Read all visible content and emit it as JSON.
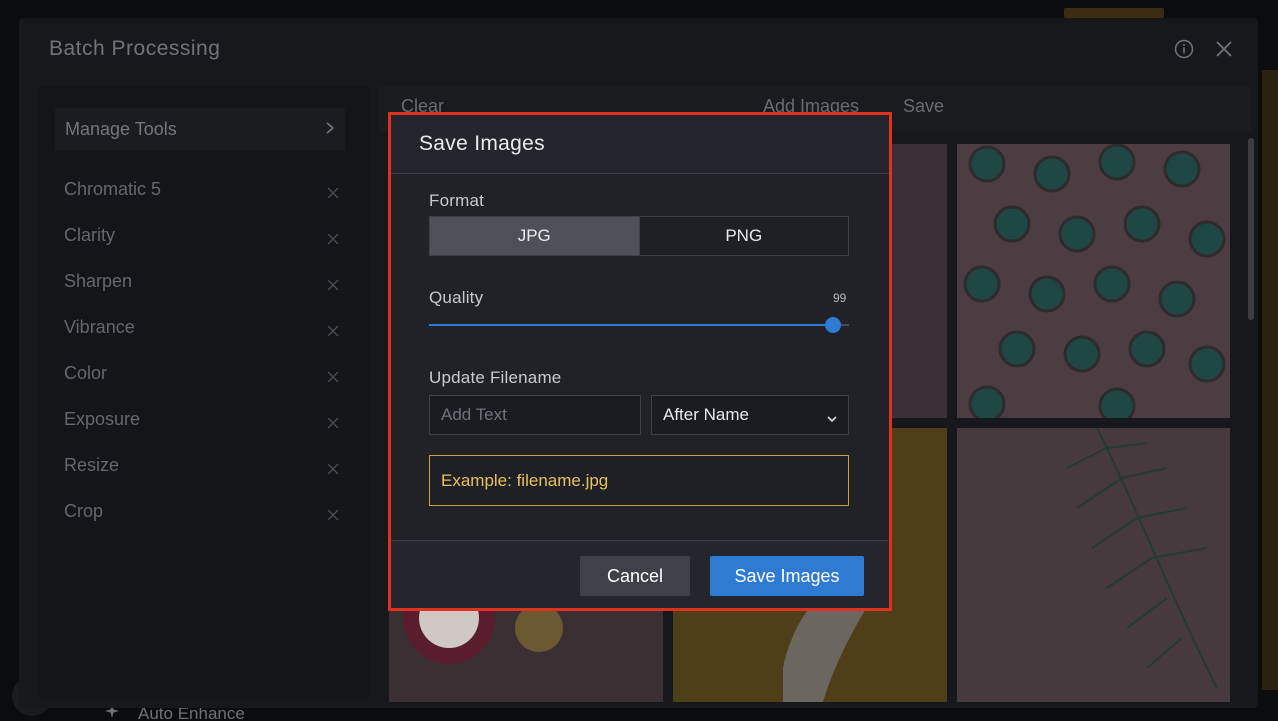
{
  "batch": {
    "title": "Batch Processing",
    "toolbar": {
      "clear_label": "Clear",
      "add_images_label": "Add Images",
      "save_label": "Save"
    },
    "sidebar": {
      "manage_tools_label": "Manage Tools",
      "tools": [
        {
          "label": "Chromatic 5"
        },
        {
          "label": "Clarity"
        },
        {
          "label": "Sharpen"
        },
        {
          "label": "Vibrance"
        },
        {
          "label": "Color"
        },
        {
          "label": "Exposure"
        },
        {
          "label": "Resize"
        },
        {
          "label": "Crop"
        }
      ]
    },
    "background_menu_item": "Auto Enhance"
  },
  "modal": {
    "title": "Save Images",
    "format": {
      "label": "Format",
      "options": [
        "JPG",
        "PNG"
      ],
      "selected": "JPG"
    },
    "quality": {
      "label": "Quality",
      "value": "99",
      "min": 0,
      "max": 100
    },
    "filename": {
      "label": "Update Filename",
      "input_placeholder": "Add Text",
      "input_value": "",
      "position_selected": "After Name",
      "example": "Example: filename.jpg"
    },
    "buttons": {
      "cancel_label": "Cancel",
      "save_label": "Save Images"
    }
  },
  "colors": {
    "accent_blue": "#2f7ad3",
    "highlight_border": "#e0301e",
    "example_text": "#e6c25d",
    "example_border": "#c8a33c"
  },
  "icons": {
    "info": "info-icon",
    "close": "close-icon",
    "chevron": "chevron-right-icon",
    "remove": "remove-tool-icon",
    "dropdown": "chevron-down-icon"
  }
}
